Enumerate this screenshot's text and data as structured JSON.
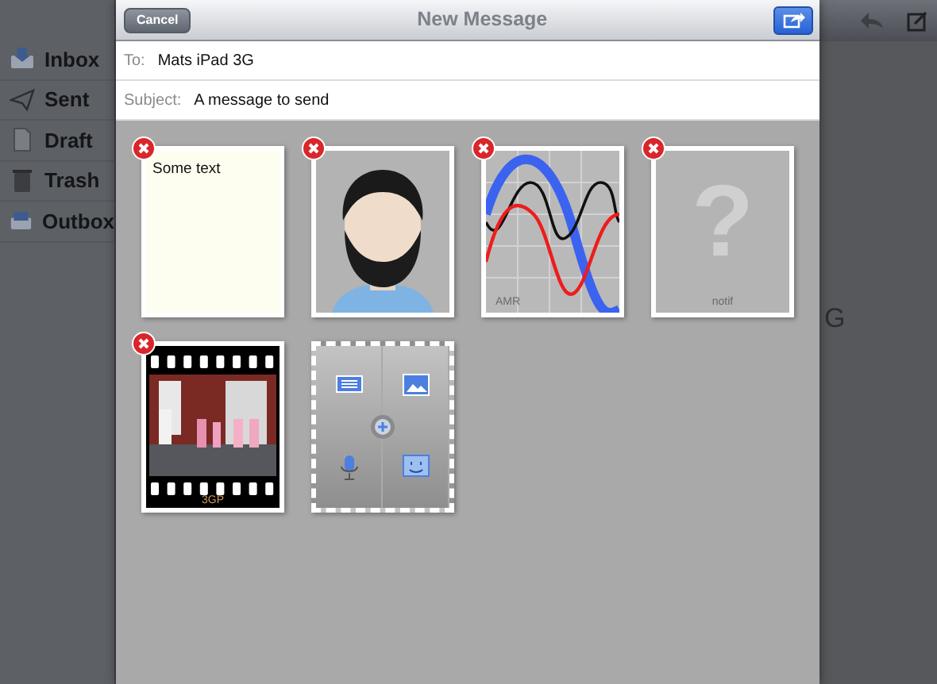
{
  "background": {
    "sidebar": [
      {
        "kind": "inbox",
        "label": "Inbox"
      },
      {
        "kind": "sent",
        "label": "Sent"
      },
      {
        "kind": "draft",
        "label": "Draft"
      },
      {
        "kind": "trash",
        "label": "Trash"
      },
      {
        "kind": "outbox",
        "label": "Outbox"
      }
    ],
    "partial_text": "G"
  },
  "dialog": {
    "title": "New Message",
    "cancel": "Cancel",
    "to_label": "To:",
    "to_value": "Mats iPad 3G",
    "subject_label": "Subject:",
    "subject_value": "A message to send"
  },
  "attachments": [
    {
      "kind": "text",
      "text": "Some text"
    },
    {
      "kind": "avatar"
    },
    {
      "kind": "audio",
      "label": "AMR"
    },
    {
      "kind": "unknown",
      "glyph": "?",
      "label": "notif"
    },
    {
      "kind": "video",
      "label": "3GP"
    },
    {
      "kind": "add"
    }
  ]
}
